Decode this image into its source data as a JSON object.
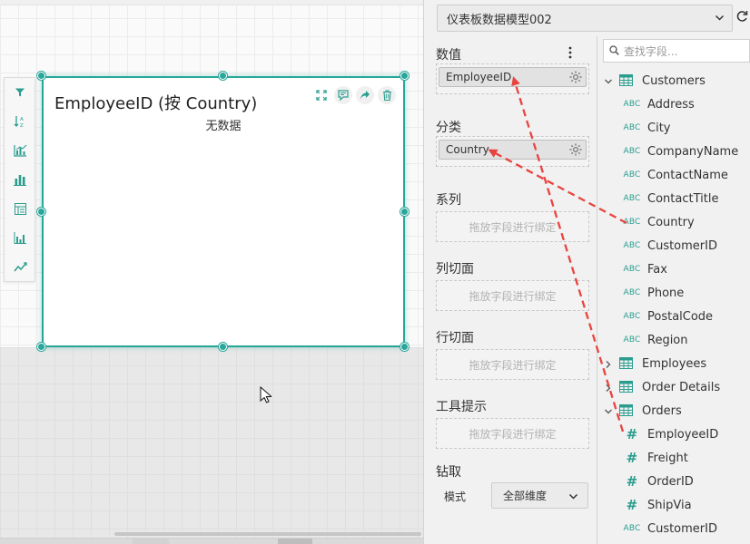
{
  "widget": {
    "title": "EmployeeID (按 Country)",
    "empty_text": "无数据"
  },
  "toolbar": {
    "icons": [
      "filter-icon",
      "sort-icon",
      "chart-type-icon",
      "bar-chart-icon",
      "table-icon",
      "column-chart-icon",
      "line-chart-icon"
    ]
  },
  "panel": {
    "model_name": "仪表板数据模型002",
    "sections": {
      "values_label": "数值",
      "values_field": "EmployeeID",
      "category_label": "分类",
      "category_field": "Country",
      "series_label": "系列",
      "series_placeholder": "拖放字段进行绑定",
      "col_slice_label": "列切面",
      "col_slice_placeholder": "拖放字段进行绑定",
      "row_slice_label": "行切面",
      "row_slice_placeholder": "拖放字段进行绑定",
      "tooltip_label": "工具提示",
      "tooltip_placeholder": "拖放字段进行绑定",
      "drill_label": "钻取",
      "mode_label": "模式",
      "mode_value": "全部维度"
    }
  },
  "fields": {
    "search_placeholder": "查找字段...",
    "tables": [
      {
        "name": "Customers",
        "expanded": true,
        "fields": [
          {
            "type": "ABC",
            "name": "Address"
          },
          {
            "type": "ABC",
            "name": "City"
          },
          {
            "type": "ABC",
            "name": "CompanyName"
          },
          {
            "type": "ABC",
            "name": "ContactName"
          },
          {
            "type": "ABC",
            "name": "ContactTitle"
          },
          {
            "type": "ABC",
            "name": "Country"
          },
          {
            "type": "ABC",
            "name": "CustomerID"
          },
          {
            "type": "ABC",
            "name": "Fax"
          },
          {
            "type": "ABC",
            "name": "Phone"
          },
          {
            "type": "ABC",
            "name": "PostalCode"
          },
          {
            "type": "ABC",
            "name": "Region"
          }
        ]
      },
      {
        "name": "Employees",
        "expanded": false,
        "fields": []
      },
      {
        "name": "Order Details",
        "expanded": false,
        "fields": []
      },
      {
        "name": "Orders",
        "expanded": true,
        "fields": [
          {
            "type": "#",
            "name": "EmployeeID"
          },
          {
            "type": "#",
            "name": "Freight"
          },
          {
            "type": "#",
            "name": "OrderID"
          },
          {
            "type": "#",
            "name": "ShipVia"
          },
          {
            "type": "ABC",
            "name": "CustomerID"
          }
        ]
      }
    ]
  },
  "colors": {
    "accent": "#25a79a",
    "arrow": "#e8443f"
  }
}
